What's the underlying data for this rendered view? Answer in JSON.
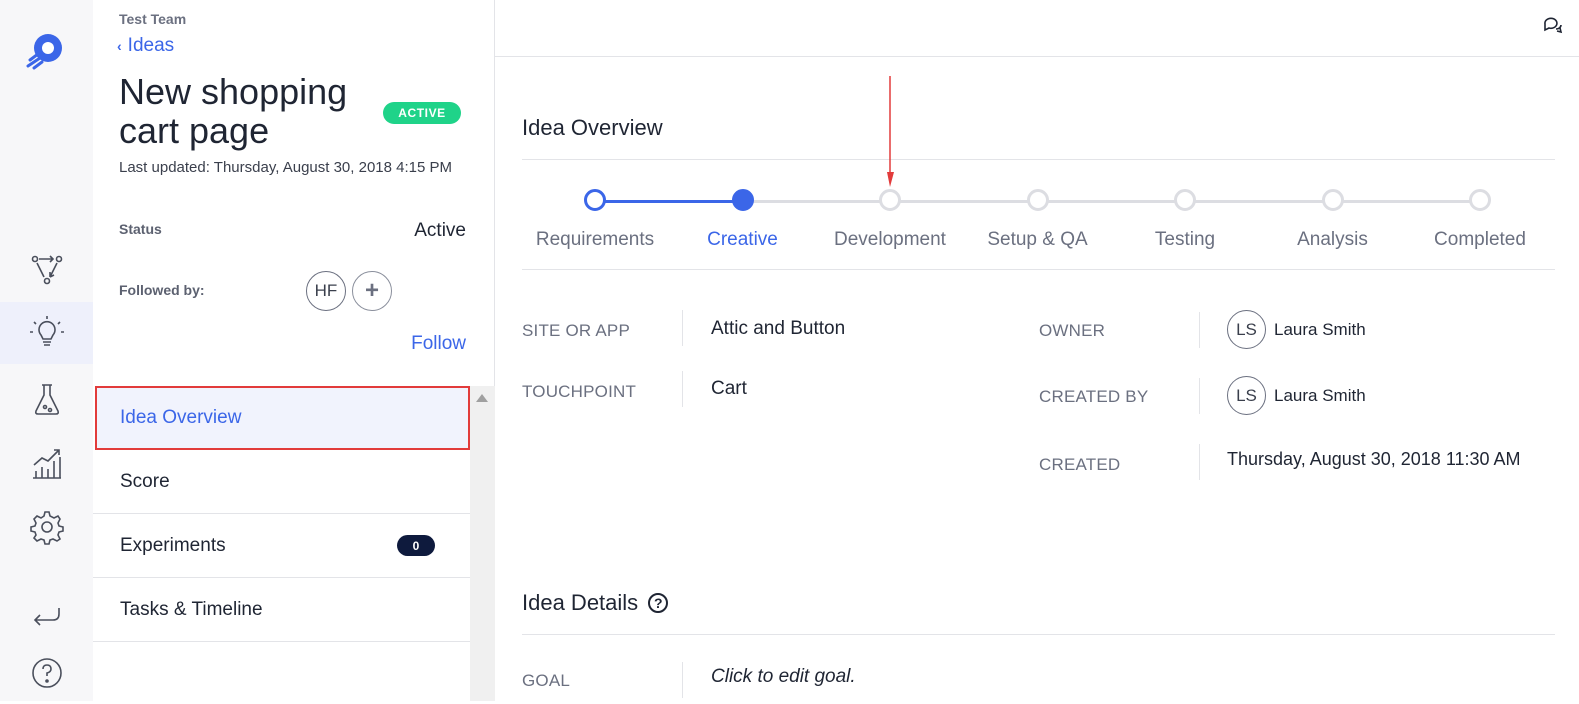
{
  "rail": {
    "icons": [
      "rocket-logo-icon",
      "workflow-icon",
      "lightbulb-icon",
      "flask-icon",
      "analytics-chart-icon",
      "gear-icon",
      "return-icon",
      "help-icon"
    ]
  },
  "sidebar": {
    "team": "Test Team",
    "back_label": "Ideas",
    "title": "New shopping cart page",
    "status_badge": "ACTIVE",
    "last_updated": "Last updated: Thursday, August 30, 2018 4:15 PM",
    "status_label": "Status",
    "status_value": "Active",
    "followed_label": "Followed by:",
    "followers": [
      "HF"
    ],
    "add_follower_symbol": "+",
    "follow_label": "Follow",
    "menu": [
      {
        "label": "Idea Overview",
        "badge": ""
      },
      {
        "label": "Score",
        "badge": ""
      },
      {
        "label": "Experiments",
        "badge": "0"
      },
      {
        "label": "Tasks & Timeline",
        "badge": ""
      }
    ]
  },
  "overview": {
    "title": "Idea Overview",
    "steps": [
      "Requirements",
      "Creative",
      "Development",
      "Setup & QA",
      "Testing",
      "Analysis",
      "Completed"
    ],
    "current_step": 1,
    "fields_left": [
      {
        "label": "SITE OR APP",
        "value": "Attic and Button"
      },
      {
        "label": "TOUCHPOINT",
        "value": "Cart"
      }
    ],
    "owner": {
      "label": "OWNER",
      "initials": "LS",
      "name": "Laura Smith"
    },
    "created_by": {
      "label": "CREATED BY",
      "initials": "LS",
      "name": "Laura Smith"
    },
    "created": {
      "label": "CREATED",
      "value": "Thursday, August 30, 2018 11:30 AM"
    }
  },
  "details": {
    "title": "Idea Details",
    "help_symbol": "?",
    "goal_label": "GOAL",
    "goal_value": "Click to edit goal."
  },
  "colors": {
    "accent": "#3b66e8",
    "active_badge": "#1fd389",
    "annotation": "#e23b3b",
    "count_badge": "#0e1a3d"
  }
}
